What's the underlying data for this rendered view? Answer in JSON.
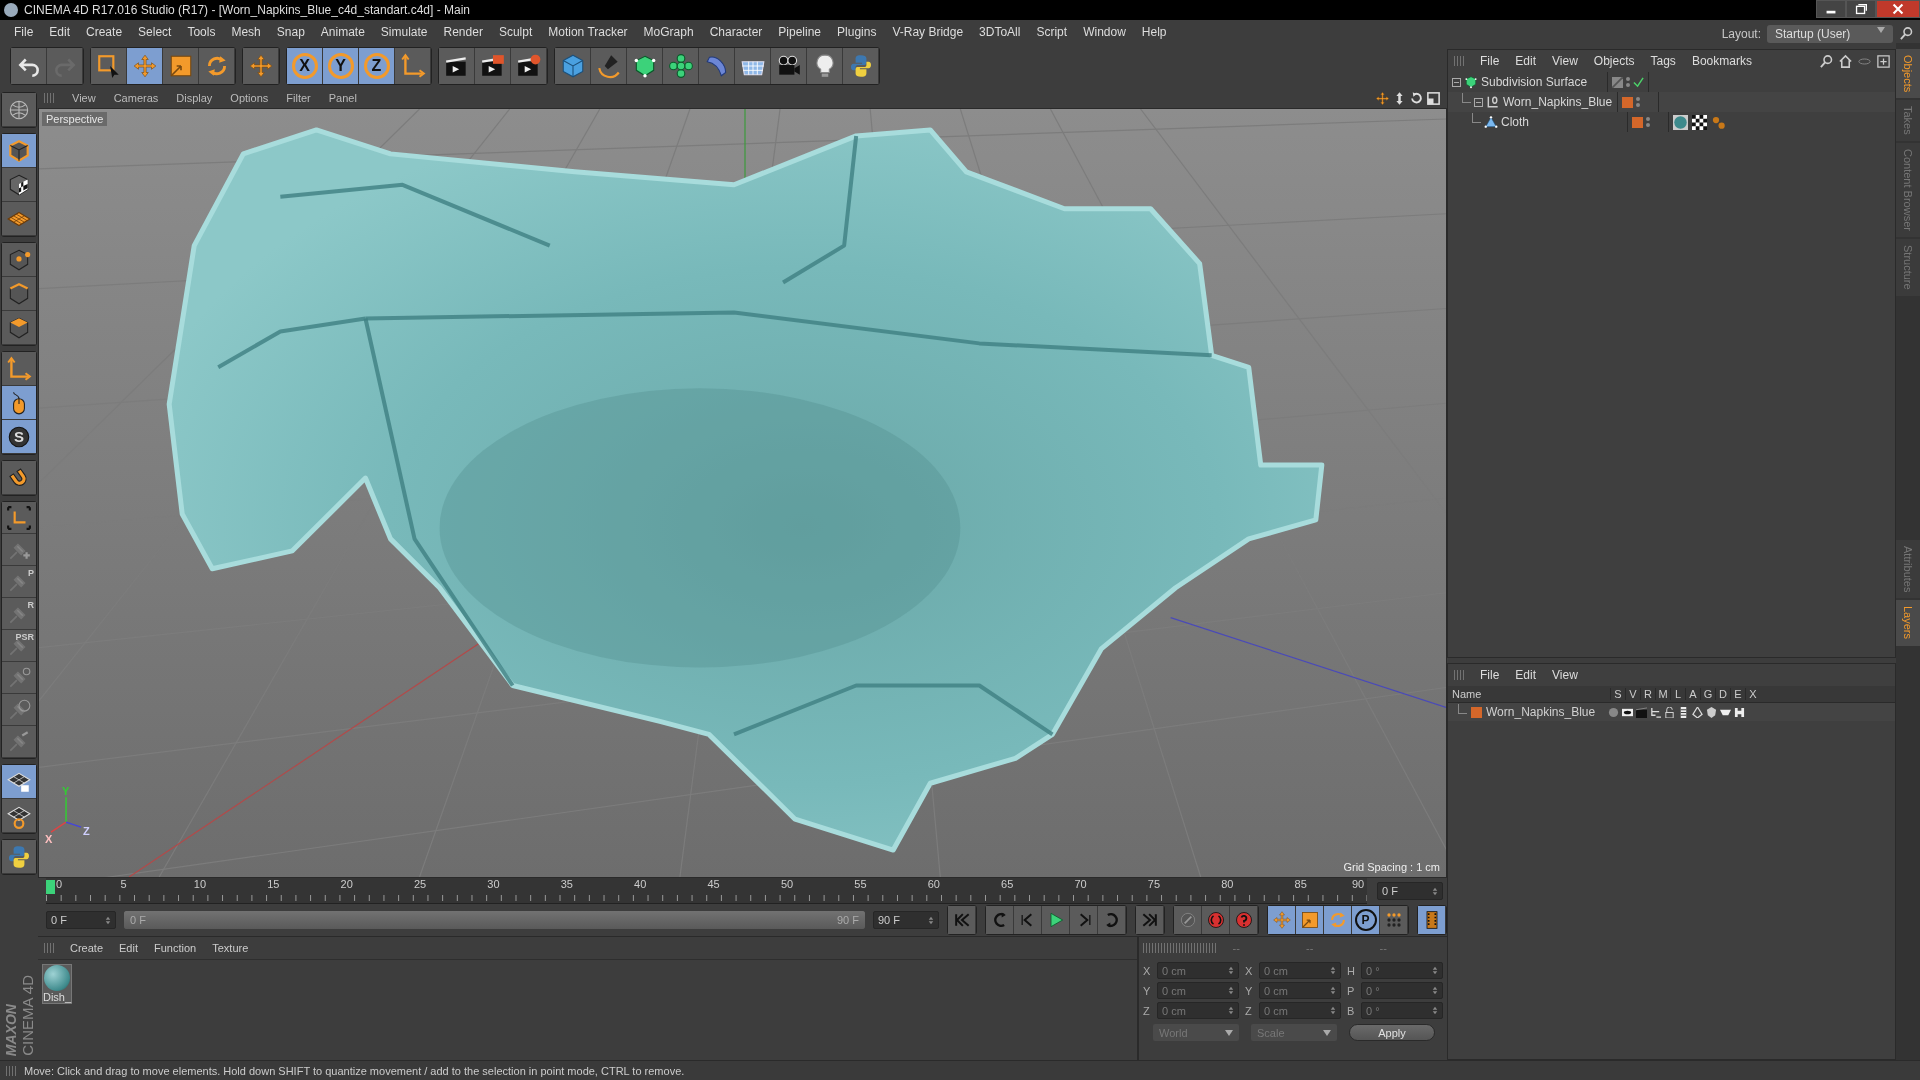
{
  "window": {
    "title": "CINEMA 4D R17.016 Studio (R17) - [Worn_Napkins_Blue_c4d_standart.c4d] - Main"
  },
  "menu": [
    "File",
    "Edit",
    "Create",
    "Select",
    "Tools",
    "Mesh",
    "Snap",
    "Animate",
    "Simulate",
    "Render",
    "Sculpt",
    "Motion Tracker",
    "MoGraph",
    "Character",
    "Pipeline",
    "Plugins",
    "V-Ray Bridge",
    "3DToAll",
    "Script",
    "Window",
    "Help"
  ],
  "layout": {
    "label": "Layout:",
    "value": "Startup (User)"
  },
  "toolbar": [
    [
      {
        "kind": "undo",
        "selected": false
      },
      {
        "kind": "redo",
        "selected": false
      }
    ],
    [
      {
        "kind": "select",
        "selected": false
      },
      {
        "kind": "move",
        "selected": true
      },
      {
        "kind": "scale",
        "selected": false
      },
      {
        "kind": "rotate",
        "selected": false
      }
    ],
    [
      {
        "kind": "recent-move",
        "selected": false
      }
    ],
    [
      {
        "kind": "axis",
        "label": "X",
        "selected": true
      },
      {
        "kind": "axis",
        "label": "Y",
        "selected": true
      },
      {
        "kind": "axis",
        "label": "Z",
        "selected": true
      },
      {
        "kind": "coordinate-system",
        "selected": false
      }
    ],
    [
      {
        "kind": "render-view",
        "selected": false
      },
      {
        "kind": "render",
        "selected": false
      },
      {
        "kind": "render-settings",
        "selected": false
      }
    ],
    [
      {
        "kind": "cube",
        "selected": false
      },
      {
        "kind": "pen",
        "selected": false
      },
      {
        "kind": "subdivision",
        "selected": false
      },
      {
        "kind": "cloner",
        "selected": false
      },
      {
        "kind": "deformer",
        "selected": false
      },
      {
        "kind": "floor",
        "selected": false
      },
      {
        "kind": "camera",
        "selected": false
      },
      {
        "kind": "light",
        "selected": false
      },
      {
        "kind": "python",
        "selected": false
      }
    ]
  ],
  "left_tools": [
    [
      {
        "kind": "make-editable",
        "selected": false
      }
    ],
    [
      {
        "kind": "model",
        "selected": true
      },
      {
        "kind": "texture",
        "selected": false
      },
      {
        "kind": "workplane",
        "selected": false
      }
    ],
    [
      {
        "kind": "points",
        "selected": false
      },
      {
        "kind": "edges",
        "selected": false
      },
      {
        "kind": "polygons",
        "selected": false
      }
    ],
    [
      {
        "kind": "axis-mode",
        "selected": false
      },
      {
        "kind": "tweak",
        "selected": true
      },
      {
        "kind": "solo",
        "label": "S",
        "selected": true
      }
    ],
    [
      {
        "kind": "snap",
        "selected": false
      }
    ],
    [
      {
        "kind": "workplane-axis",
        "selected": false
      },
      {
        "kind": "pin-add",
        "selected": false
      },
      {
        "kind": "pin",
        "label": "P",
        "selected": false
      },
      {
        "kind": "pin",
        "label": "R",
        "selected": false
      },
      {
        "kind": "pin",
        "label": "PSR",
        "selected": false
      },
      {
        "kind": "pin-target",
        "selected": false
      },
      {
        "kind": "pin-sphere",
        "selected": false
      },
      {
        "kind": "pin-edit",
        "selected": false
      }
    ],
    [
      {
        "kind": "grid-lock",
        "selected": true
      },
      {
        "kind": "grid-rotate",
        "selected": false
      }
    ],
    [
      {
        "kind": "python",
        "selected": false
      }
    ]
  ],
  "brand": {
    "company": "MAXON",
    "product": "CINEMA 4D"
  },
  "viewport": {
    "menu": [
      "View",
      "Cameras",
      "Display",
      "Options",
      "Filter",
      "Panel"
    ],
    "camera": "Perspective",
    "grid_spacing": "Grid Spacing : 1 cm",
    "axes": [
      "Y",
      "X",
      "Z"
    ]
  },
  "timeline": {
    "ticks": [
      "0",
      "5",
      "10",
      "15",
      "20",
      "25",
      "30",
      "35",
      "40",
      "45",
      "50",
      "55",
      "60",
      "65",
      "70",
      "75",
      "80",
      "85",
      "90"
    ],
    "current": "0 F",
    "start": "0 F",
    "range_start": "0 F",
    "range_end": "90 F",
    "level": 1,
    "end": "90 F"
  },
  "transport": [
    {
      "kind": "first",
      "selected": false
    },
    {
      "kind": "prev-key",
      "selected": false
    },
    {
      "kind": "prev-frame",
      "selected": false
    },
    {
      "kind": "play",
      "selected": false
    },
    {
      "kind": "next-frame",
      "selected": false
    },
    {
      "kind": "next-key",
      "selected": false
    },
    {
      "kind": "last",
      "selected": false
    }
  ],
  "record": [
    {
      "kind": "motion-record",
      "selected": false
    },
    {
      "kind": "record",
      "selected": false
    },
    {
      "kind": "auto-key",
      "selected": false
    }
  ],
  "key_tools": [
    {
      "kind": "key-move",
      "selected": true
    },
    {
      "kind": "key-scale",
      "selected": true
    },
    {
      "kind": "key-rotate",
      "selected": true
    },
    {
      "kind": "key-param",
      "label": "P",
      "selected": true
    },
    {
      "kind": "key-points",
      "selected": false
    },
    {
      "kind": "timeline-window",
      "selected": true
    }
  ],
  "materials": {
    "menu": [
      "Create",
      "Edit",
      "Function",
      "Texture"
    ],
    "items": [
      {
        "name": "Dish_"
      }
    ]
  },
  "coordinates": {
    "headers": [
      "--",
      "--",
      "--"
    ],
    "rows": [
      [
        {
          "axis": "X",
          "value": "0 cm"
        },
        {
          "axis": "X",
          "value": "0 cm"
        },
        {
          "axis": "H",
          "value": "0 °"
        }
      ],
      [
        {
          "axis": "Y",
          "value": "0 cm"
        },
        {
          "axis": "Y",
          "value": "0 cm"
        },
        {
          "axis": "P",
          "value": "0 °"
        }
      ],
      [
        {
          "axis": "Z",
          "value": "0 cm"
        },
        {
          "axis": "Z",
          "value": "0 cm"
        },
        {
          "axis": "B",
          "value": "0 °"
        }
      ]
    ],
    "dropdowns": [
      "World",
      "Scale"
    ],
    "apply": "Apply"
  },
  "objects": {
    "menu": [
      "File",
      "Edit",
      "View",
      "Objects",
      "Tags",
      "Bookmarks"
    ],
    "tree": [
      {
        "name": "Subdivision Surface",
        "kind": "subdivision",
        "expanded": true,
        "enabled": true,
        "children": [
          {
            "name": "Worn_Napkins_Blue",
            "kind": "null",
            "expanded": true,
            "color": "#d4672a",
            "children": [
              {
                "name": "Cloth",
                "kind": "polygon",
                "color": "#d4672a",
                "tags": [
                  {
                    "kind": "material"
                  },
                  {
                    "kind": "checker"
                  },
                  {
                    "kind": "dots"
                  }
                ]
              }
            ]
          }
        ]
      }
    ]
  },
  "layers": {
    "menu": [
      "File",
      "Edit",
      "View"
    ],
    "columns": [
      "Name",
      "S",
      "V",
      "R",
      "M",
      "L",
      "A",
      "G",
      "D",
      "E",
      "X"
    ],
    "rows": [
      {
        "name": "Worn_Napkins_Blue",
        "color": "#d4672a"
      }
    ]
  },
  "side_tabs_top": [
    {
      "label": "Objects",
      "selected": true
    },
    {
      "label": "Takes",
      "selected": false
    },
    {
      "label": "Content Browser",
      "selected": false
    },
    {
      "label": "Structure",
      "selected": false
    }
  ],
  "side_tabs_bottom": [
    {
      "label": "Attributes",
      "selected": false
    },
    {
      "label": "Layers",
      "selected": true
    }
  ],
  "status": "Move: Click and drag to move elements. Hold down SHIFT to quantize movement / add to the selection in point mode, CTRL to remove."
}
